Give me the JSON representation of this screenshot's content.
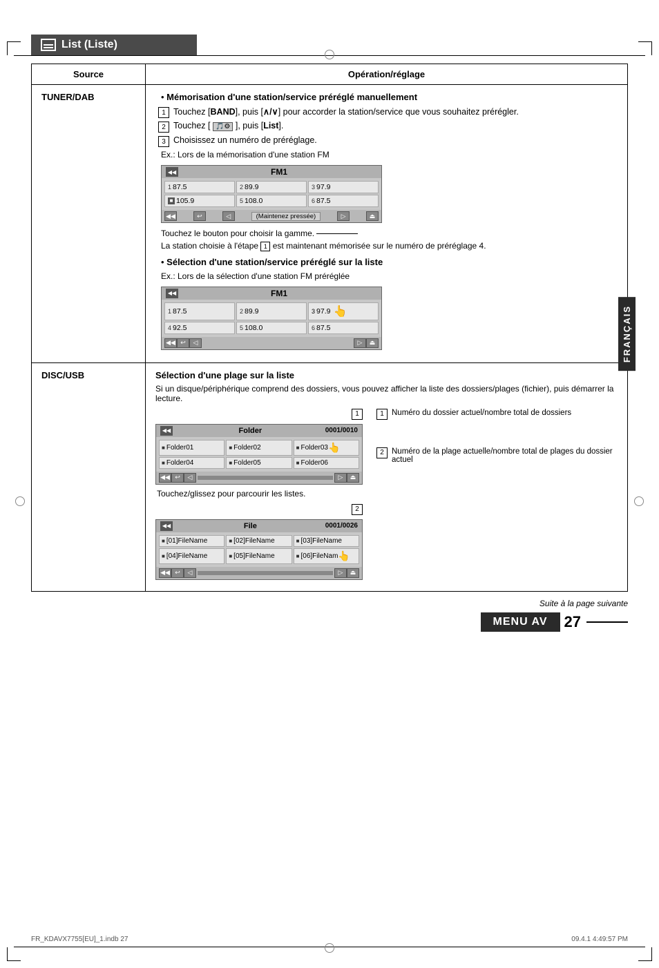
{
  "page": {
    "title": "List (Liste)",
    "language_sidebar": "FRANÇAIS",
    "bottom_note": "Suite à la page suivante",
    "menu_label": "MENU AV",
    "page_number": "27",
    "footer_file": "FR_KDAVX7755[EU]_1.indb   27",
    "footer_date": "09.4.1   4:49:57 PM"
  },
  "table": {
    "header_source": "Source",
    "header_operation": "Opération/réglage",
    "rows": [
      {
        "source": "TUNER/DAB",
        "operations": [
          {
            "type": "bullet_title",
            "text": "Mémorisation d'une station/service préréglé manuellement"
          },
          {
            "type": "step",
            "num": "1",
            "text": "Touchez [BAND], puis [∧/∨] pour accorder la station/service que vous souhaitez prérégler."
          },
          {
            "type": "step",
            "num": "2",
            "text": "Touchez [ ], puis [List]."
          },
          {
            "type": "step",
            "num": "3",
            "text": "Choisissez un numéro de préréglage."
          },
          {
            "type": "note",
            "text": "Ex.: Lors de la mémorisation d'une station FM"
          },
          {
            "type": "fm_display_1",
            "band": "FM1",
            "cells": [
              "87.5",
              "89.9",
              "97.9",
              "105.9",
              "108.0",
              "87.5"
            ],
            "label": "(Maintenez pressée)"
          },
          {
            "type": "note_below",
            "text": "Touchez le bouton pour choisir la gamme."
          },
          {
            "type": "note_below2",
            "text": "La station choisie à l'étape 1 est maintenant mémémorisée sur le numéro de préréglage 4."
          },
          {
            "type": "bullet_title",
            "text": "Sélection d'une station/service préréglé sur la liste"
          },
          {
            "type": "note",
            "text": "Ex.: Lors de la sélection d'une station FM préréglée"
          },
          {
            "type": "fm_display_2",
            "band": "FM1",
            "cells": [
              "87.5",
              "89.9",
              "97.9",
              "92.5",
              "108.0",
              "87.5"
            ]
          }
        ]
      },
      {
        "source": "DISC/USB",
        "operations": [
          {
            "type": "section_title",
            "text": "Sélection d'une plage sur la liste"
          },
          {
            "type": "desc",
            "text": "Si un disque/périphérique comprend des dossiers, vous pouvez afficher la liste des dossiers/plages (fichier), puis démarrer la lecture."
          },
          {
            "type": "folder_display",
            "header": "Folder",
            "counter": "0001/0010",
            "cells": [
              "Folder01",
              "Folder02",
              "Folder03",
              "Folder04",
              "Folder05",
              "Folder06"
            ],
            "note": "Touchez/glissez pour parcourir les listes."
          },
          {
            "type": "file_display",
            "header": "File",
            "counter": "0001/0026",
            "cells": [
              "[01]FileName",
              "[02]FileName",
              "[03]FileName",
              "[04]FileName",
              "[05]FileName",
              "[06]FileNam"
            ]
          }
        ]
      }
    ]
  },
  "disc_sidebar": {
    "item1_num": "1",
    "item1_text": "Numéro du dossier actuel/nombre total de dossiers",
    "item2_num": "2",
    "item2_text": "Numéro de la plage actuelle/nombre total de plages du dossier actuel"
  }
}
